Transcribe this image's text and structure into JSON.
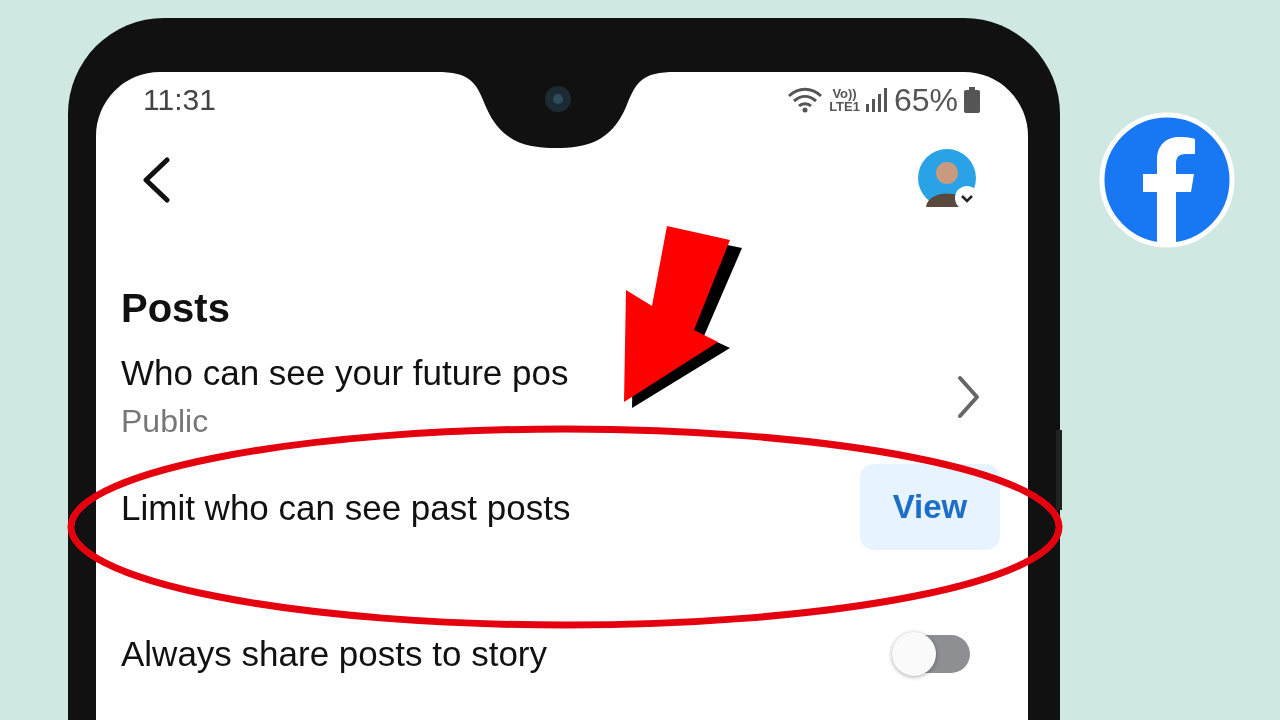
{
  "status_bar": {
    "time": "11:31",
    "network_label": [
      "Vo))",
      "LTE1"
    ],
    "battery": "65%"
  },
  "section": {
    "title": "Posts"
  },
  "items": [
    {
      "kind": "link",
      "title": "Who can see your future pos",
      "subtitle": "Public"
    },
    {
      "kind": "button",
      "title": "Limit who can see past posts",
      "button": "View"
    },
    {
      "kind": "toggle",
      "title": "Always share posts to story",
      "on": false
    }
  ]
}
